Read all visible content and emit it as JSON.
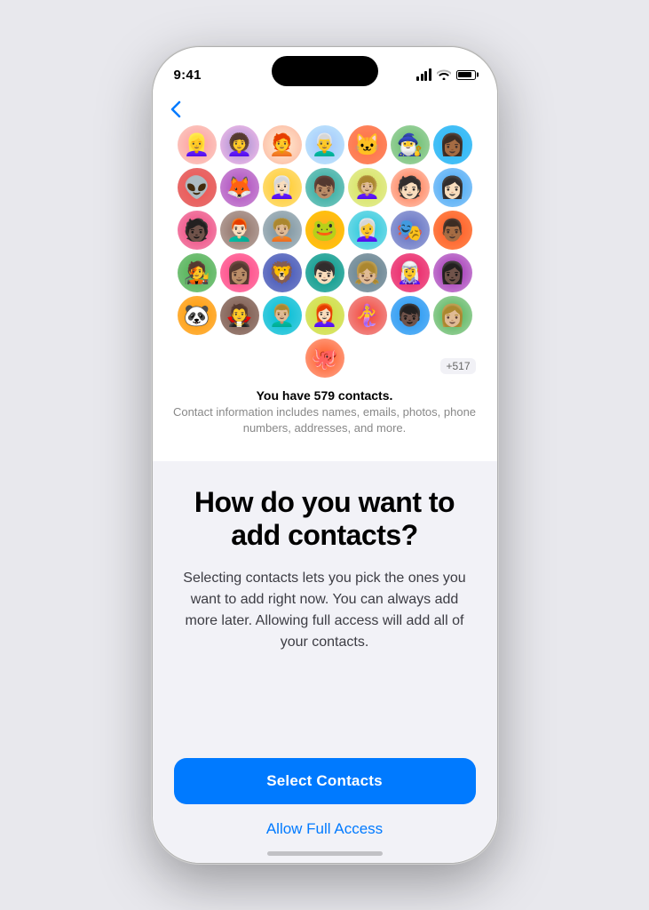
{
  "phone": {
    "status_bar": {
      "time": "9:41"
    },
    "back_button": "‹",
    "contacts": {
      "count_text": "You have 579 contacts.",
      "sub_text": "Contact information includes names, emails, photos, phone numbers, addresses, and more.",
      "more_badge": "+517"
    },
    "headline": "How do you want to add contacts?",
    "body_text": "Selecting contacts lets you pick the ones you want to add right now. You can always add more later. Allowing full access will add all of your contacts.",
    "buttons": {
      "select": "Select Contacts",
      "allow": "Allow Full Access"
    }
  },
  "avatars": [
    {
      "emoji": "👱‍♀️",
      "class": "av-0"
    },
    {
      "emoji": "👩‍🦱",
      "class": "av-1"
    },
    {
      "emoji": "🧑‍🦰",
      "class": "av-2"
    },
    {
      "emoji": "👨‍🦳",
      "class": "av-3"
    },
    {
      "emoji": "🐱",
      "class": "av-4"
    },
    {
      "emoji": "🧙‍♂️",
      "class": "av-5"
    },
    {
      "emoji": "👩🏾",
      "class": "av-6"
    },
    {
      "emoji": "👽",
      "class": "av-7"
    },
    {
      "emoji": "🦊",
      "class": "av-8"
    },
    {
      "emoji": "👩🏻‍🦳",
      "class": "av-9"
    },
    {
      "emoji": "👦🏽",
      "class": "av-10"
    },
    {
      "emoji": "👩🏼‍🦱",
      "class": "av-11"
    },
    {
      "emoji": "🧑🏻",
      "class": "av-12"
    },
    {
      "emoji": "👩🏻",
      "class": "av-13"
    },
    {
      "emoji": "🧑🏿",
      "class": "av-14"
    },
    {
      "emoji": "👨🏻‍🦰",
      "class": "av-15"
    },
    {
      "emoji": "🧑🏼‍🦱",
      "class": "av-16"
    },
    {
      "emoji": "🐸",
      "class": "av-17"
    },
    {
      "emoji": "👩‍🦳",
      "class": "av-18"
    },
    {
      "emoji": "🎭",
      "class": "av-19"
    },
    {
      "emoji": "👨🏾",
      "class": "av-20"
    },
    {
      "emoji": "🧑‍🎤",
      "class": "av-21"
    },
    {
      "emoji": "👩🏽",
      "class": "av-22"
    },
    {
      "emoji": "🦁",
      "class": "av-23"
    },
    {
      "emoji": "👦🏻",
      "class": "av-24"
    },
    {
      "emoji": "👧🏼",
      "class": "av-25"
    },
    {
      "emoji": "🧝‍♀️",
      "class": "av-26"
    },
    {
      "emoji": "👩🏿",
      "class": "av-27"
    },
    {
      "emoji": "🐼",
      "class": "av-28"
    },
    {
      "emoji": "🧛",
      "class": "av-29"
    },
    {
      "emoji": "👨🏼‍🦱",
      "class": "av-30"
    },
    {
      "emoji": "👩🏻‍🦰",
      "class": "av-31"
    },
    {
      "emoji": "🧜‍♀️",
      "class": "av-32"
    },
    {
      "emoji": "👦🏿",
      "class": "av-33"
    },
    {
      "emoji": "👩🏼",
      "class": "av-34"
    },
    {
      "emoji": "🐙",
      "class": "av-35"
    }
  ]
}
